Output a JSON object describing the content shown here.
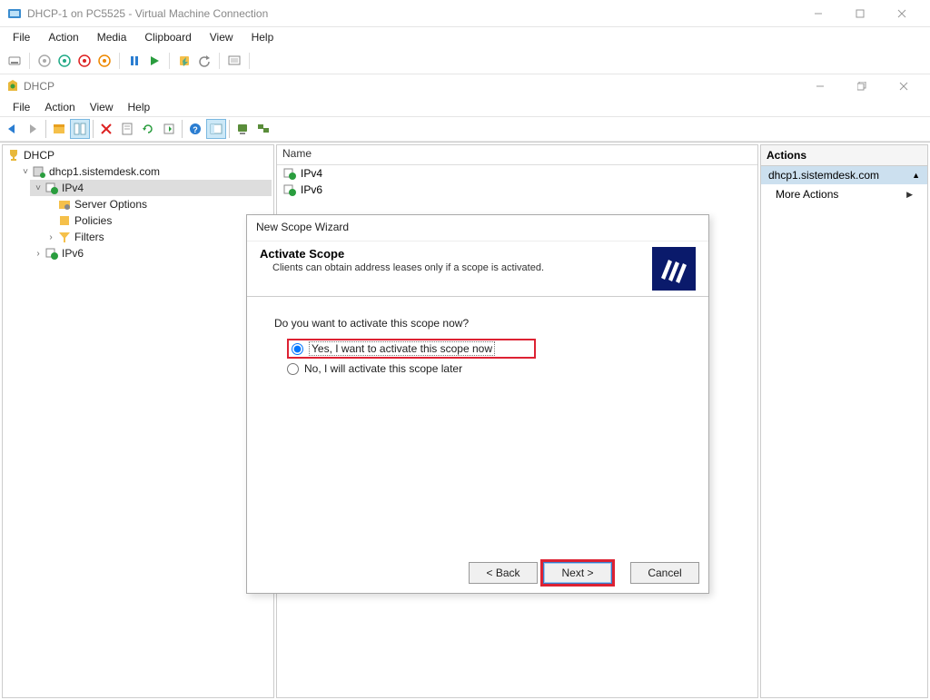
{
  "vm": {
    "title": "DHCP-1 on PC5525 - Virtual Machine Connection",
    "menus": [
      "File",
      "Action",
      "Media",
      "Clipboard",
      "View",
      "Help"
    ]
  },
  "dhcp": {
    "title": "DHCP",
    "menus": [
      "File",
      "Action",
      "View",
      "Help"
    ]
  },
  "tree": {
    "root": "DHCP",
    "server": "dhcp1.sistemdesk.com",
    "ipv4": "IPv4",
    "ipv4_children": [
      "Server Options",
      "Policies",
      "Filters"
    ],
    "ipv6": "IPv6"
  },
  "list": {
    "header": "Name",
    "items": [
      "IPv4",
      "IPv6"
    ]
  },
  "actions": {
    "header": "Actions",
    "section": "dhcp1.sistemdesk.com",
    "more": "More Actions"
  },
  "wizard": {
    "title": "New Scope Wizard",
    "header_title": "Activate Scope",
    "header_sub": "Clients can obtain address leases only if a scope is activated.",
    "question": "Do you want to activate this scope now?",
    "option_yes": "Yes, I want to activate this scope now",
    "option_no": "No, I will activate this scope later",
    "btn_back": "< Back",
    "btn_next": "Next >",
    "btn_cancel": "Cancel"
  }
}
